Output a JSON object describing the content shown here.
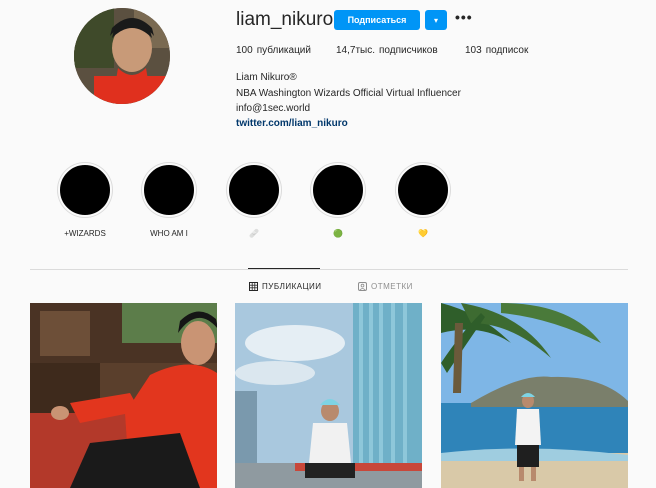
{
  "profile": {
    "username": "liam_nikuro",
    "follow_label": "Подписаться",
    "dropdown_glyph": "▾",
    "more_glyph": "•••",
    "stats": [
      {
        "count": "100",
        "label": "публикаций"
      },
      {
        "count": "14,7тыс.",
        "label": "подписчиков"
      },
      {
        "count": "103",
        "label": "подписок"
      }
    ],
    "bio_name": "Liam Nikuro®",
    "bio_desc": "NBA Washington Wizards Official Virtual Influencer",
    "bio_email": "info@1sec.world",
    "bio_link": "twitter.com/liam_nikuro"
  },
  "highlights": [
    {
      "label": "+WIZARDS"
    },
    {
      "label": "WHO AM I"
    },
    {
      "label": "🩹"
    },
    {
      "label": "🟢"
    },
    {
      "label": "💛"
    }
  ],
  "tabs": {
    "posts": "ПУБЛИКАЦИИ",
    "tagged": "ОТМЕТКИ"
  },
  "colors": {
    "accent": "#0095f6",
    "link": "#00376b",
    "background": "#fafafa",
    "divider": "#dbdbdb"
  },
  "icons": {
    "grid": "grid-icon",
    "tag": "tag-icon",
    "more": "more-icon",
    "dropdown": "chevron-down-icon"
  }
}
